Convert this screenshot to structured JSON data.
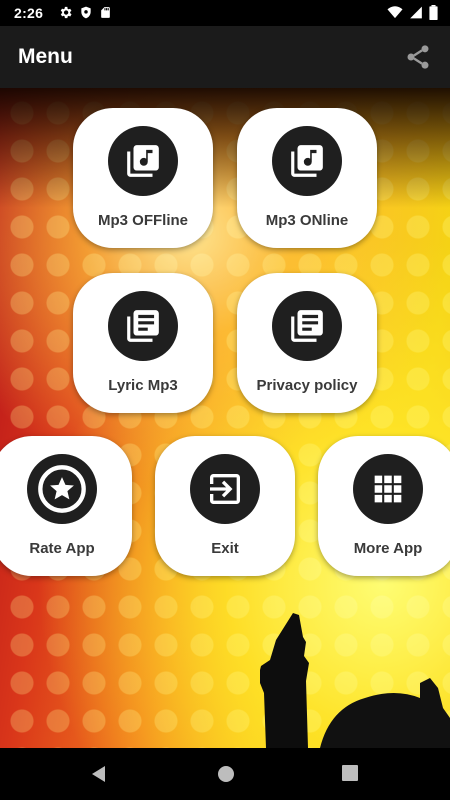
{
  "status_bar": {
    "time": "2:26",
    "left_icons": [
      "gear-icon",
      "shield-icon",
      "sd-card-icon"
    ],
    "right_icons": [
      "wifi-icon",
      "signal-icon",
      "battery-icon"
    ]
  },
  "app_bar": {
    "title": "Menu",
    "share_icon": "share-icon"
  },
  "menu": {
    "mp3_offline": {
      "label": "Mp3 OFFline",
      "icon": "music-library-icon"
    },
    "mp3_online": {
      "label": "Mp3 ONline",
      "icon": "music-library-icon"
    },
    "lyric_mp3": {
      "label": "Lyric Mp3",
      "icon": "document-library-icon"
    },
    "privacy_policy": {
      "label": "Privacy policy",
      "icon": "document-library-icon"
    },
    "rate_app": {
      "label": "Rate App",
      "icon": "star-icon"
    },
    "exit": {
      "label": "Exit",
      "icon": "exit-icon"
    },
    "more_app": {
      "label": "More App",
      "icon": "grid-icon"
    }
  },
  "nav_bar": {
    "back_icon": "back-icon",
    "home_icon": "home-icon",
    "recents_icon": "recents-icon"
  },
  "colors": {
    "app_bar": "#1b1b1b",
    "tile": "#ffffff",
    "icon_circle": "#1f1f1f",
    "label": "#3a3a3a"
  }
}
